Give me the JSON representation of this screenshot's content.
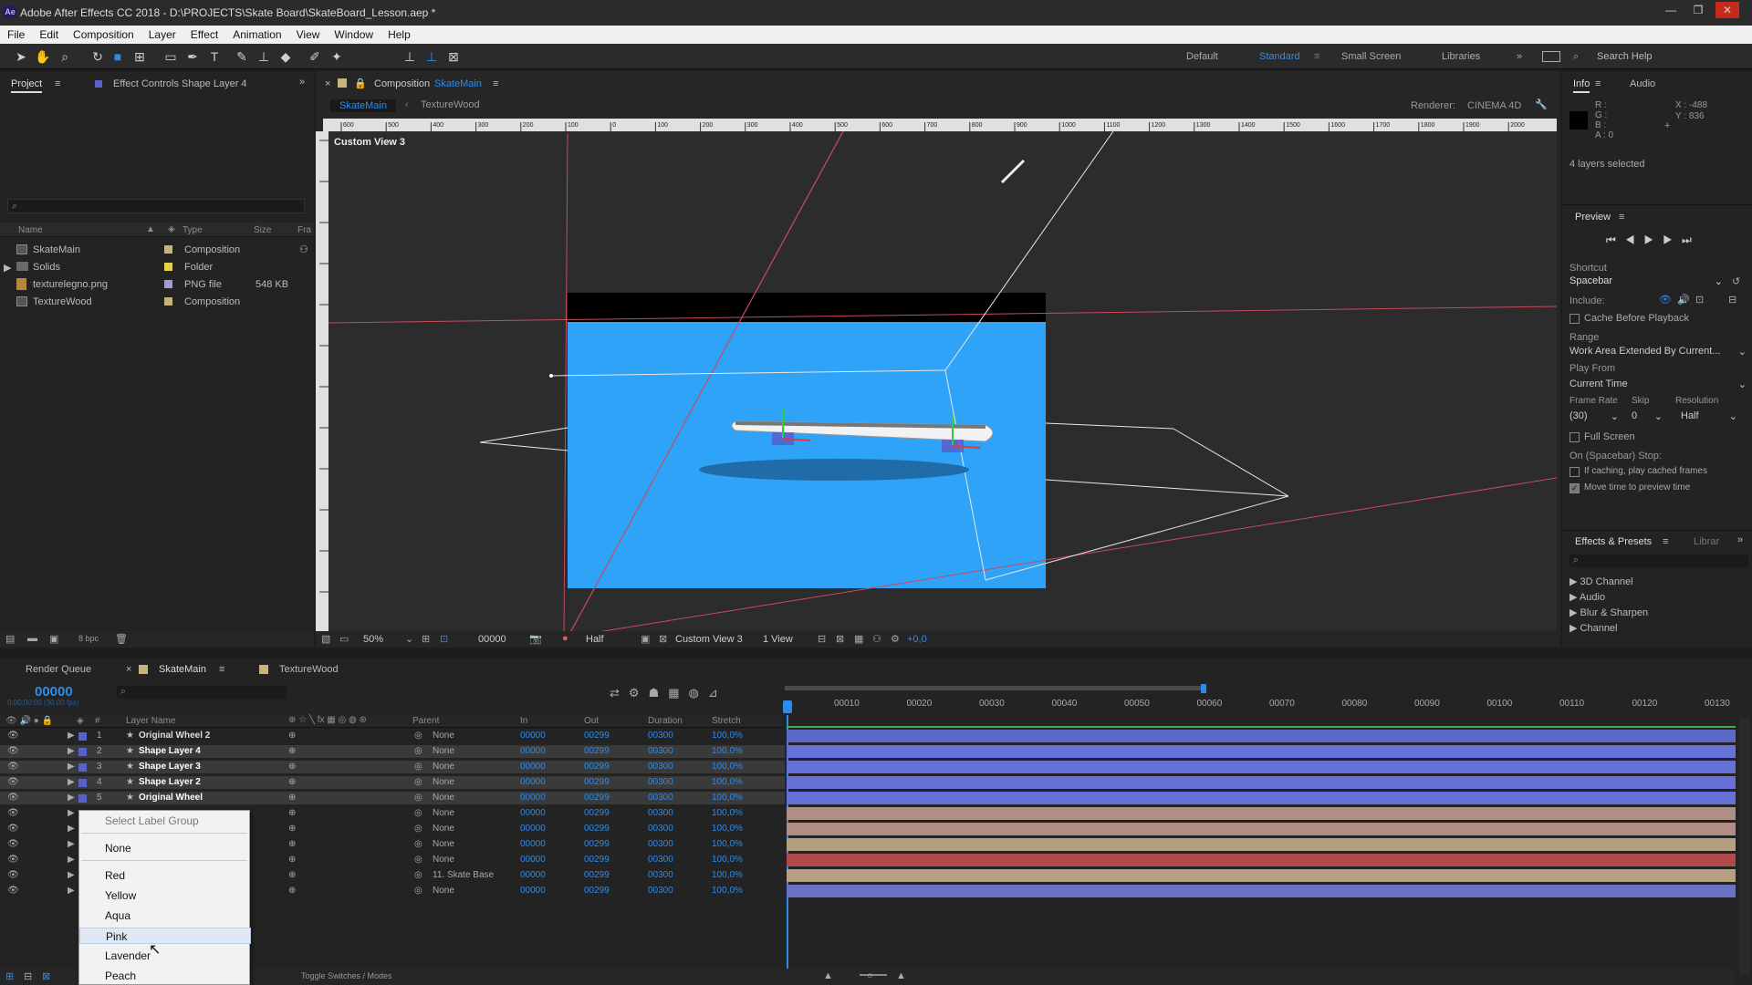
{
  "window": {
    "title": "Adobe After Effects CC 2018 - D:\\PROJECTS\\Skate Board\\SkateBoard_Lesson.aep *",
    "controls": [
      "—",
      "❐",
      "✕"
    ]
  },
  "menu": [
    "File",
    "Edit",
    "Composition",
    "Layer",
    "Effect",
    "Animation",
    "View",
    "Window",
    "Help"
  ],
  "workspaces": {
    "default": "Default",
    "standard": "Standard",
    "small": "Small Screen",
    "libraries": "Libraries",
    "search": "Search Help"
  },
  "project": {
    "tab": "Project",
    "effect_controls": "Effect Controls Shape Layer 4",
    "columns": [
      "Name",
      "Type",
      "Size",
      "Fra"
    ],
    "items": [
      {
        "name": "SkateMain",
        "type": "Composition",
        "size": "",
        "color": "#c8b27d"
      },
      {
        "name": "Solids",
        "type": "Folder",
        "size": "",
        "color": "#e3d24a"
      },
      {
        "name": "texturelegno.png",
        "type": "PNG file",
        "size": "548 KB",
        "color": "#a39bd1"
      },
      {
        "name": "TextureWood",
        "type": "Composition",
        "size": "",
        "color": "#c8b27d"
      }
    ],
    "bpc": "8 bpc"
  },
  "composition": {
    "header": "Composition",
    "header_name": "SkateMain",
    "tabs": [
      "SkateMain",
      "TextureWood"
    ],
    "renderer_label": "Renderer:",
    "renderer": "CINEMA 4D",
    "view_label": "Custom View 3",
    "ruler": [
      "600",
      "500",
      "400",
      "300",
      "200",
      "100",
      "0",
      "100",
      "200",
      "300",
      "400",
      "500",
      "600",
      "700",
      "800",
      "900",
      "1000",
      "1100",
      "1200",
      "1300",
      "1400",
      "1500",
      "1600",
      "1700",
      "1800",
      "1900",
      "2000"
    ],
    "footer": {
      "zoom": "50%",
      "time": "00000",
      "resolution": "Half",
      "view": "Custom View 3",
      "views": "1 View",
      "exposure": "+0,0"
    }
  },
  "info": {
    "tabs": [
      "Info",
      "Audio"
    ],
    "rgba": [
      "R :",
      "G :",
      "B :",
      "A : 0"
    ],
    "xy": [
      "X : -488",
      "Y : 836"
    ],
    "selected": "4 layers selected"
  },
  "preview": {
    "title": "Preview",
    "shortcut_label": "Shortcut",
    "shortcut": "Spacebar",
    "include_label": "Include:",
    "cache": "Cache Before Playback",
    "range_label": "Range",
    "range": "Work Area Extended By Current...",
    "play_from_label": "Play From",
    "play_from": "Current Time",
    "frame_rate_label": "Frame Rate",
    "skip_label": "Skip",
    "resolution_label": "Resolution",
    "frame_rate": "(30)",
    "skip": "0",
    "resolution": "Half",
    "full_screen": "Full Screen",
    "on_stop": "On (Spacebar) Stop:",
    "if_caching": "If caching, play cached frames",
    "move_time": "Move time to preview time"
  },
  "effects": {
    "tab": "Effects & Presets",
    "tab2": "Librar",
    "items": [
      "3D Channel",
      "Audio",
      "Blur & Sharpen",
      "Channel"
    ]
  },
  "timeline": {
    "tabs": [
      "Render Queue",
      "SkateMain",
      "TextureWood"
    ],
    "timecode": "00000",
    "subtime": "0:00:00:00 (30.00 fps)",
    "columns": {
      "layer": "Layer Name",
      "parent": "Parent",
      "in": "In",
      "out": "Out",
      "duration": "Duration",
      "stretch": "Stretch"
    },
    "ruler": [
      "00010",
      "00020",
      "00030",
      "00040",
      "00050",
      "00060",
      "00070",
      "00080",
      "00090",
      "00100",
      "00110",
      "00120",
      "00130"
    ],
    "layers": [
      {
        "num": "1",
        "name": "Original Wheel 2",
        "parent": "None",
        "in": "00000",
        "out": "00299",
        "dur": "00300",
        "stretch": "100,0%",
        "label": "#5960c8",
        "bar": "#5e68c8",
        "selected": false
      },
      {
        "num": "2",
        "name": "Shape Layer 4",
        "parent": "None",
        "in": "00000",
        "out": "00299",
        "dur": "00300",
        "stretch": "100,0%",
        "label": "#5960c8",
        "bar": "#6670d6",
        "selected": true
      },
      {
        "num": "3",
        "name": "Shape Layer 3",
        "parent": "None",
        "in": "00000",
        "out": "00299",
        "dur": "00300",
        "stretch": "100,0%",
        "label": "#5960c8",
        "bar": "#6670d6",
        "selected": true
      },
      {
        "num": "4",
        "name": "Shape Layer 2",
        "parent": "None",
        "in": "00000",
        "out": "00299",
        "dur": "00300",
        "stretch": "100,0%",
        "label": "#5960c8",
        "bar": "#6670d6",
        "selected": true
      },
      {
        "num": "5",
        "name": "Original Wheel",
        "parent": "None",
        "in": "00000",
        "out": "00299",
        "dur": "00300",
        "stretch": "100,0%",
        "label": "#5960c8",
        "bar": "#6670d6",
        "selected": true
      },
      {
        "num": "",
        "name": "",
        "parent": "None",
        "in": "00000",
        "out": "00299",
        "dur": "00300",
        "stretch": "100,0%",
        "label": "",
        "bar": "#b08e86",
        "selected": false
      },
      {
        "num": "",
        "name": "",
        "parent": "None",
        "in": "00000",
        "out": "00299",
        "dur": "00300",
        "stretch": "100,0%",
        "label": "",
        "bar": "#b08e86",
        "selected": false
      },
      {
        "num": "",
        "name": "",
        "parent": "None",
        "in": "00000",
        "out": "00299",
        "dur": "00300",
        "stretch": "100,0%",
        "label": "",
        "bar": "#b59f82",
        "selected": false
      },
      {
        "num": "",
        "name": "",
        "parent": "None",
        "in": "00000",
        "out": "00299",
        "dur": "00300",
        "stretch": "100,0%",
        "label": "",
        "bar": "#b04a4a",
        "selected": false
      },
      {
        "num": "",
        "name": "",
        "parent": "11. Skate Base",
        "in": "00000",
        "out": "00299",
        "dur": "00300",
        "stretch": "100,0%",
        "label": "",
        "bar": "#b59f82",
        "selected": false
      },
      {
        "num": "",
        "name": "",
        "parent": "None",
        "in": "00000",
        "out": "00299",
        "dur": "00300",
        "stretch": "100,0%",
        "label": "",
        "bar": "#6a72c6",
        "selected": false
      }
    ],
    "toggle": "Toggle Switches / Modes"
  },
  "label_menu": {
    "header": "Select Label Group",
    "items": [
      "None",
      "Red",
      "Yellow",
      "Aqua",
      "Pink",
      "Lavender",
      "Peach"
    ],
    "highlighted": "Pink"
  },
  "colors": {
    "accent": "#2d8ceb",
    "canvas": "#2ea3f8",
    "panel": "#232323"
  }
}
